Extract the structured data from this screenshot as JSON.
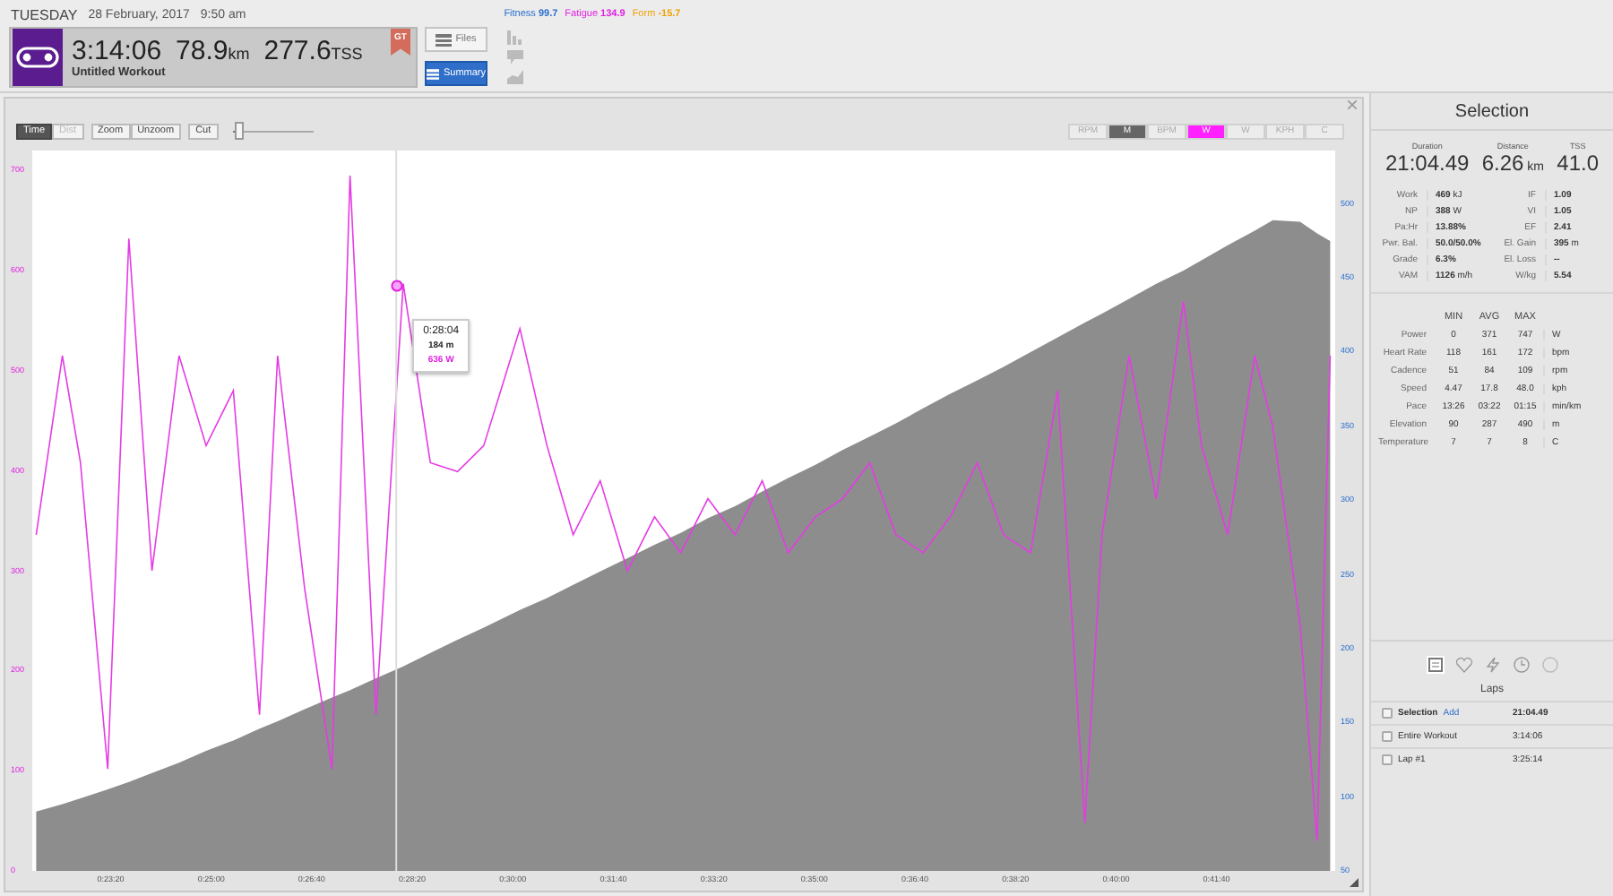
{
  "header": {
    "day": "TUESDAY",
    "date": "28 February, 2017",
    "time": "9:50 am",
    "metrics": [
      {
        "label": "Fitness",
        "value": "99.7",
        "color": "#2a6fcf"
      },
      {
        "label": "Fatigue",
        "value": "134.9",
        "color": "#e01fe0"
      },
      {
        "label": "Form",
        "value": "-15.7",
        "color": "#f0a000"
      }
    ],
    "duration": "3:14:06",
    "distance": "78.9",
    "distance_unit": "km",
    "tss": "277.6",
    "tss_unit": "TSS",
    "title": "Untitled Workout",
    "badge": "GT",
    "buttons": [
      {
        "label": "Files",
        "selected": false
      },
      {
        "label": "Summary",
        "selected": true
      }
    ]
  },
  "toolbar": {
    "modes": [
      {
        "label": "Time",
        "selected": true
      },
      {
        "label": "Dist",
        "selected": false
      }
    ],
    "zoom": [
      {
        "label": "Zoom"
      },
      {
        "label": "Unzoom"
      }
    ],
    "cut": "Cut",
    "slider": {
      "level": 0.08
    },
    "channels": [
      {
        "label": "RPM",
        "selected": false
      },
      {
        "label": "M",
        "selected": true,
        "color": "#666666"
      },
      {
        "label": "BPM",
        "selected": false
      },
      {
        "label": "W",
        "selected": true,
        "color": "#ff1fff"
      },
      {
        "label": "W",
        "selected": false
      },
      {
        "label": "KPH",
        "selected": false
      },
      {
        "label": "C",
        "selected": false
      }
    ]
  },
  "chart": {
    "chart_data": {
      "type": "line",
      "xlim": [
        1322,
        2618
      ],
      "ylim": [
        0,
        720
      ],
      "xticks": [
        {
          "value": 1400,
          "label": "0:23:20"
        },
        {
          "value": 1500,
          "label": "0:25:00"
        },
        {
          "value": 1600,
          "label": "0:26:40"
        },
        {
          "value": 1700,
          "label": "0:28:20"
        },
        {
          "value": 1800,
          "label": "0:30:00"
        },
        {
          "value": 1900,
          "label": "0:31:40"
        },
        {
          "value": 2000,
          "label": "0:33:20"
        },
        {
          "value": 2100,
          "label": "0:35:00"
        },
        {
          "value": 2200,
          "label": "0:36:40"
        },
        {
          "value": 2300,
          "label": "0:38:20"
        },
        {
          "value": 2400,
          "label": "0:40:00"
        },
        {
          "value": 2500,
          "label": "0:41:40"
        }
      ],
      "yticks": [
        {
          "value": 700,
          "label": "700"
        },
        {
          "value": 600,
          "label": "600"
        },
        {
          "value": 500,
          "label": "500"
        },
        {
          "value": 400,
          "label": "400"
        },
        {
          "value": 300,
          "label": "300"
        },
        {
          "value": 200,
          "label": "200"
        },
        {
          "value": 100,
          "label": "100"
        },
        {
          "value": 0,
          "label": "0"
        }
      ],
      "x": [
        1326,
        1352,
        1370,
        1397,
        1418,
        1441,
        1468,
        1495,
        1522,
        1548,
        1566,
        1593,
        1620,
        1638,
        1664,
        1691,
        1718,
        1745,
        1771,
        1807,
        1834,
        1860,
        1887,
        1914,
        1941,
        1967,
        1994,
        2021,
        2048,
        2074,
        2101,
        2128,
        2155,
        2181,
        2208,
        2235,
        2262,
        2288,
        2315,
        2342,
        2369,
        2386,
        2413,
        2440,
        2467,
        2485,
        2511,
        2538,
        2556,
        2583,
        2600,
        2613
      ],
      "y2lim": [
        50,
        536
      ],
      "y2ticks": [
        {
          "value": 500,
          "label": "500"
        },
        {
          "value": 450,
          "label": "450"
        },
        {
          "value": 400,
          "label": "400"
        },
        {
          "value": 350,
          "label": "350"
        },
        {
          "value": 300,
          "label": "300"
        },
        {
          "value": 250,
          "label": "250"
        },
        {
          "value": 200,
          "label": "200"
        },
        {
          "value": 150,
          "label": "150"
        },
        {
          "value": 100,
          "label": "100"
        },
        {
          "value": 50,
          "label": "50"
        }
      ],
      "ref_lines": [
        {
          "axis": "x",
          "value": 1684
        }
      ],
      "series": [
        {
          "type": "area",
          "axis": "y2",
          "color": "#8d8d8d",
          "values": [
            90,
            95,
            99,
            105,
            110,
            116,
            123,
            131,
            138,
            146,
            151,
            159,
            167,
            172,
            180,
            188,
            197,
            206,
            214,
            226,
            234,
            243,
            252,
            261,
            270,
            278,
            288,
            296,
            306,
            315,
            324,
            334,
            343,
            352,
            362,
            372,
            381,
            390,
            400,
            410,
            420,
            426,
            436,
            446,
            455,
            462,
            472,
            482,
            489,
            488,
            480,
            475
          ]
        },
        {
          "color": "#e53be5",
          "values": [
            336,
            515,
            408,
            102,
            632,
            300,
            515,
            425,
            480,
            156,
            515,
            282,
            102,
            695,
            156,
            587,
            408,
            399,
            425,
            542,
            425,
            336,
            390,
            300,
            354,
            318,
            372,
            336,
            390,
            318,
            354,
            372,
            408,
            336,
            318,
            354,
            408,
            336,
            318,
            480,
            48,
            336,
            515,
            372,
            569,
            425,
            336,
            515,
            444,
            246,
            30,
            515
          ]
        }
      ]
    },
    "tooltip": {
      "time": "0:28:04",
      "elevation": "184",
      "elevation_unit": "m",
      "power": "636",
      "power_unit": "W"
    }
  },
  "selection": {
    "title": "Selection",
    "summary": [
      {
        "label": "Duration",
        "value": "21:04.49"
      },
      {
        "label": "Distance",
        "value": "6.26",
        "unit": "km"
      },
      {
        "label": "TSS",
        "value": "41.0"
      }
    ],
    "left_stats": [
      {
        "label": "Work",
        "value": "469",
        "unit": "kJ"
      },
      {
        "label": "NP",
        "value": "388",
        "unit": "W"
      },
      {
        "label": "Pa:Hr",
        "value": "13.88%"
      },
      {
        "label": "Pwr. Bal.",
        "value": "50.0/50.0%"
      },
      {
        "label": "Grade",
        "value": "6.3%"
      },
      {
        "label": "VAM",
        "value": "1126",
        "unit": "m/h"
      }
    ],
    "right_stats": [
      {
        "label": "IF",
        "value": "1.09"
      },
      {
        "label": "VI",
        "value": "1.05"
      },
      {
        "label": "EF",
        "value": "2.41"
      },
      {
        "label": "El. Gain",
        "value": "395",
        "unit": "m"
      },
      {
        "label": "El. Loss",
        "value": "--"
      },
      {
        "label": "W/kg",
        "value": "5.54"
      }
    ],
    "columns": [
      "MIN",
      "AVG",
      "MAX"
    ],
    "rows": [
      {
        "label": "Power",
        "min": "0",
        "avg": "371",
        "max": "747",
        "unit": "W"
      },
      {
        "label": "Heart Rate",
        "min": "118",
        "avg": "161",
        "max": "172",
        "unit": "bpm"
      },
      {
        "label": "Cadence",
        "min": "51",
        "avg": "84",
        "max": "109",
        "unit": "rpm"
      },
      {
        "label": "Speed",
        "min": "4.47",
        "avg": "17.8",
        "max": "48.0",
        "unit": "kph"
      },
      {
        "label": "Pace",
        "min": "13:26",
        "avg": "03:22",
        "max": "01:15",
        "unit": "min/km"
      },
      {
        "label": "Elevation",
        "min": "90",
        "avg": "287",
        "max": "490",
        "unit": "m"
      },
      {
        "label": "Temperature",
        "min": "7",
        "avg": "7",
        "max": "8",
        "unit": "C"
      }
    ]
  },
  "panel_tabs": [
    {
      "kind": "laps",
      "selected": true
    },
    {
      "kind": "heart",
      "selected": false
    },
    {
      "kind": "bolt",
      "selected": false
    },
    {
      "kind": "clock",
      "selected": false
    },
    {
      "kind": "circle",
      "selected": false
    }
  ],
  "laps": {
    "title": "Laps",
    "items": [
      {
        "label": "Selection",
        "link": "Add",
        "time": "21:04.49",
        "checked": false,
        "bold": true
      },
      {
        "label": "Entire Workout",
        "time": "3:14:06",
        "checked": false,
        "bold": false
      },
      {
        "label": "Lap #1",
        "time": "3:25:14",
        "checked": false,
        "bold": false
      }
    ]
  }
}
